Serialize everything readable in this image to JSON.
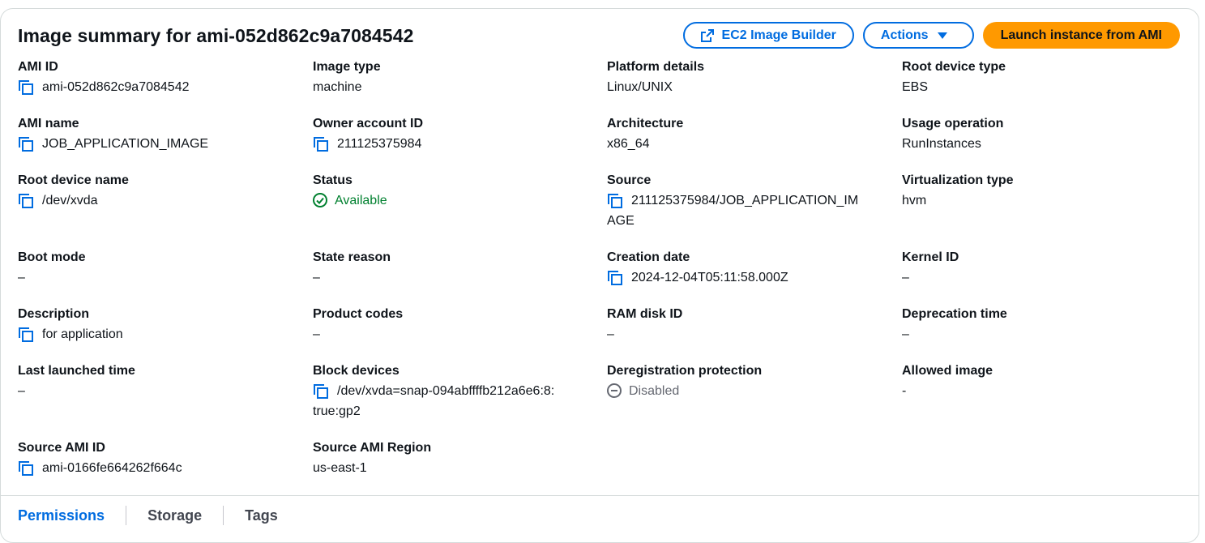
{
  "header": {
    "title": "Image summary for ami-052d862c9a7084542",
    "buttons": {
      "image_builder": "EC2 Image Builder",
      "actions": "Actions",
      "launch": "Launch instance from AMI"
    }
  },
  "fields": {
    "ami_id": {
      "label": "AMI ID",
      "value": "ami-052d862c9a7084542"
    },
    "image_type": {
      "label": "Image type",
      "value": "machine"
    },
    "platform_details": {
      "label": "Platform details",
      "value": "Linux/UNIX"
    },
    "root_device_type": {
      "label": "Root device type",
      "value": "EBS"
    },
    "ami_name": {
      "label": "AMI name",
      "value": "JOB_APPLICATION_IMAGE"
    },
    "owner_account_id": {
      "label": "Owner account ID",
      "value": "211125375984"
    },
    "architecture": {
      "label": "Architecture",
      "value": "x86_64"
    },
    "usage_operation": {
      "label": "Usage operation",
      "value": "RunInstances"
    },
    "root_device_name": {
      "label": "Root device name",
      "value": "/dev/xvda"
    },
    "status": {
      "label": "Status",
      "value": "Available"
    },
    "source": {
      "label": "Source",
      "value_line1": "211125375984/JOB_APPLICATION_IM",
      "value_line2": "AGE"
    },
    "virtualization_type": {
      "label": "Virtualization type",
      "value": "hvm"
    },
    "boot_mode": {
      "label": "Boot mode",
      "value": "–"
    },
    "state_reason": {
      "label": "State reason",
      "value": "–"
    },
    "creation_date": {
      "label": "Creation date",
      "value": "2024-12-04T05:11:58.000Z"
    },
    "kernel_id": {
      "label": "Kernel ID",
      "value": "–"
    },
    "description": {
      "label": "Description",
      "value": "for application"
    },
    "product_codes": {
      "label": "Product codes",
      "value": "–"
    },
    "ram_disk_id": {
      "label": "RAM disk ID",
      "value": "–"
    },
    "deprecation_time": {
      "label": "Deprecation time",
      "value": "–"
    },
    "last_launched_time": {
      "label": "Last launched time",
      "value": "–"
    },
    "block_devices": {
      "label": "Block devices",
      "value_line1": "/dev/xvda=snap-094abffffb212a6e6:8:",
      "value_line2": "true:gp2"
    },
    "deregistration_protection": {
      "label": "Deregistration protection",
      "value": "Disabled"
    },
    "allowed_image": {
      "label": "Allowed image",
      "value": "-"
    },
    "source_ami_id": {
      "label": "Source AMI ID",
      "value": "ami-0166fe664262f664c"
    },
    "source_ami_region": {
      "label": "Source AMI Region",
      "value": "us-east-1"
    }
  },
  "tabs": [
    "Permissions",
    "Storage",
    "Tags"
  ],
  "colors": {
    "accent": "#006ce0",
    "primary": "#ff9900",
    "success": "#00802f",
    "border": "#d5dbdb"
  },
  "icons": {
    "copy": "copy-icon",
    "external": "external-link-icon",
    "check": "status-success-icon",
    "disabled": "status-stopped-icon"
  }
}
